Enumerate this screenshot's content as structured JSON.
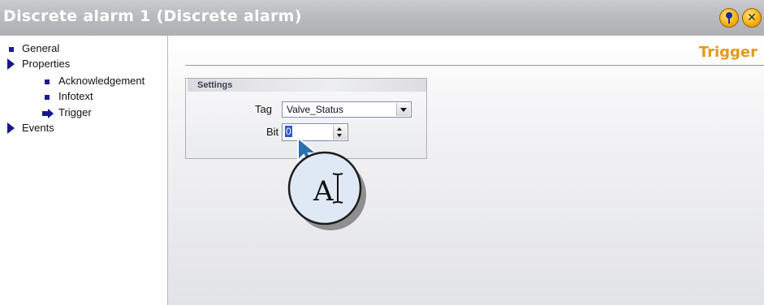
{
  "window": {
    "title": "Discrete alarm 1 (Discrete alarm)",
    "pin_button": "pin-icon",
    "close_button": "close-icon",
    "accent_color": "#e29a1a"
  },
  "tree": {
    "items": [
      {
        "label": "General",
        "icon": "square-bullet-icon"
      },
      {
        "label": "Properties",
        "icon": "expand-triangle-icon"
      },
      {
        "label": "Acknowledgement",
        "icon": "square-bullet-icon"
      },
      {
        "label": "Infotext",
        "icon": "square-bullet-icon"
      },
      {
        "label": "Trigger",
        "icon": "selected-arrow-icon"
      },
      {
        "label": "Events",
        "icon": "expand-triangle-icon"
      }
    ],
    "selected": "Trigger"
  },
  "content": {
    "heading": "Trigger",
    "settings": {
      "group_title": "Settings",
      "tag_label": "Tag",
      "tag_value": "Valve_Status",
      "bit_label": "Bit",
      "bit_value": "0"
    }
  },
  "overlay": {
    "badge_text": "A",
    "icon": "text-cursor-icon"
  }
}
